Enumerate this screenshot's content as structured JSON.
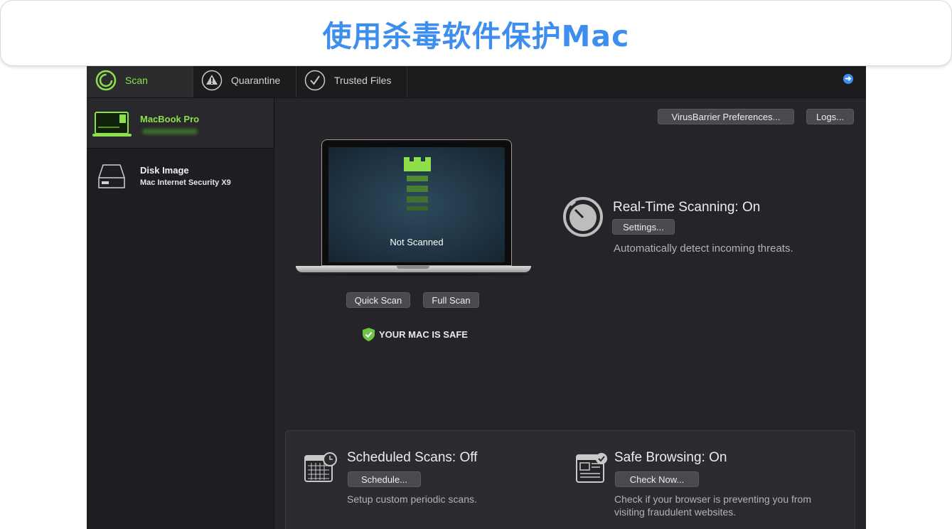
{
  "banner": {
    "title": "使用杀毒软件保护Mac"
  },
  "colors": {
    "accent_green": "#8ee04a",
    "banner_blue": "#3d8eed"
  },
  "toolbar": {
    "tabs": [
      {
        "label": "Scan",
        "icon": "scan-progress-icon",
        "selected": true
      },
      {
        "label": "Quarantine",
        "icon": "warning-triangle-icon",
        "selected": false
      },
      {
        "label": "Trusted Files",
        "icon": "checkmark-circle-icon",
        "selected": false
      }
    ],
    "help_icon": "help-arrow-icon"
  },
  "sidebar": {
    "items": [
      {
        "name": "MacBook Pro",
        "icon": "laptop-icon",
        "selected": true
      },
      {
        "name": "Disk Image",
        "subtitle": "Mac Internet Security X9",
        "icon": "disk-drive-icon",
        "selected": false
      }
    ]
  },
  "main": {
    "prefs_button": "VirusBarrier Preferences...",
    "logs_button": "Logs...",
    "scan_status": "Not Scanned",
    "quick_scan_button": "Quick Scan",
    "full_scan_button": "Full Scan",
    "safe_status": "YOUR MAC IS SAFE",
    "realtime": {
      "title": "Real-Time Scanning: On",
      "button": "Settings...",
      "description": "Automatically detect incoming threats."
    },
    "scheduled": {
      "title": "Scheduled Scans: Off",
      "button": "Schedule...",
      "description": "Setup custom periodic scans."
    },
    "browsing": {
      "title": "Safe Browsing: On",
      "button": "Check Now...",
      "description_line1": "Check if your browser is preventing you from",
      "description_line2": "visiting fraudulent websites."
    }
  }
}
